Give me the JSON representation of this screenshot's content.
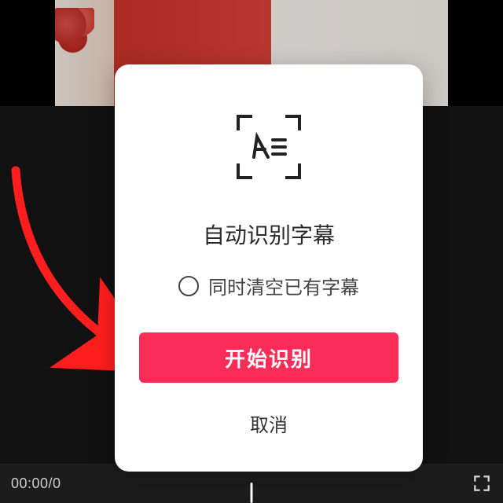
{
  "modal": {
    "title": "自动识别字幕",
    "option_clear": "同时清空已有字幕",
    "primary": "开始识别",
    "cancel": "取消"
  },
  "player": {
    "time": "00:00/0"
  },
  "icons": {
    "scan": "subtitle-scan-icon",
    "fullscreen": "fullscreen-icon",
    "radio": "radio-unchecked-icon"
  },
  "accent": "#fa2d58",
  "arrow_target": "primary-button"
}
